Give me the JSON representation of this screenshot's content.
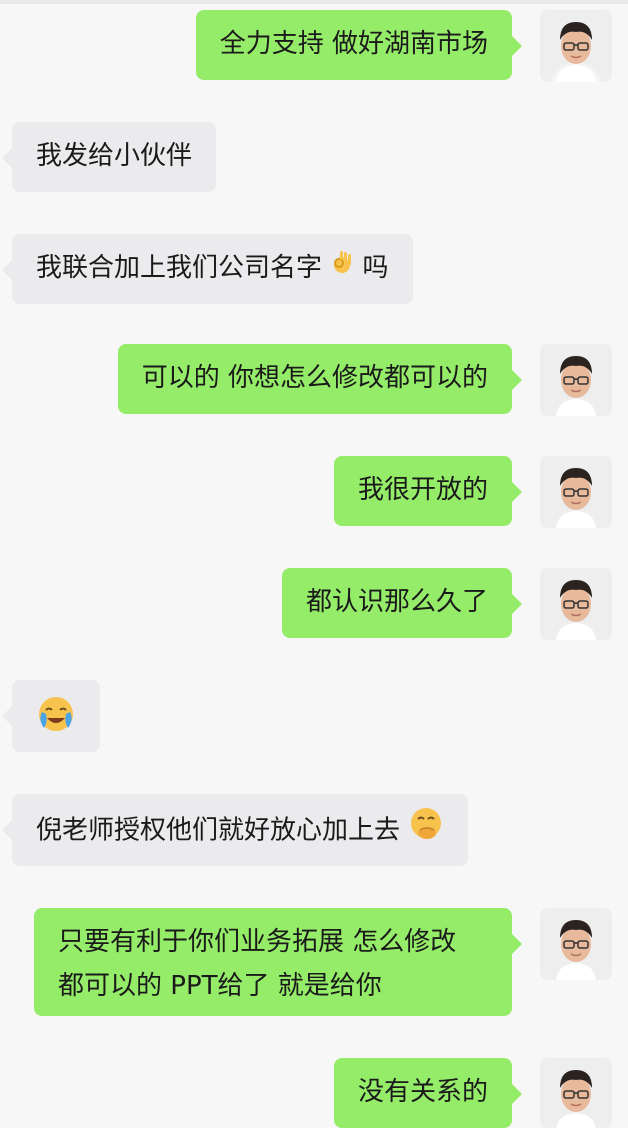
{
  "colors": {
    "outgoing_bubble": "#95ec69",
    "incoming_bubble": "#ebebed",
    "background": "#f7f7f7"
  },
  "messages": [
    {
      "side": "out",
      "text": "全力支持 做好湖南市场"
    },
    {
      "side": "in",
      "text": "我发给小伙伴"
    },
    {
      "side": "in",
      "text": "我联合加上我们公司名字",
      "trail": "吗",
      "emoji": "ok-hand-emoji"
    },
    {
      "side": "out",
      "text": "可以的 你想怎么修改都可以的"
    },
    {
      "side": "out",
      "text": "我很开放的"
    },
    {
      "side": "out",
      "text": "都认识那么久了"
    },
    {
      "side": "in",
      "text": "",
      "emoji": "loudly-crying-face-emoji"
    },
    {
      "side": "in",
      "text": "倪老师授权他们就好放心加上去",
      "emoji": "face-with-hand-over-mouth-emoji"
    },
    {
      "side": "out",
      "text_line1": "只要有利于你们业务拓展 怎么修改",
      "text_line2": "都可以的 PPT给了 就是给你"
    },
    {
      "side": "out",
      "text": "没有关系的"
    }
  ]
}
